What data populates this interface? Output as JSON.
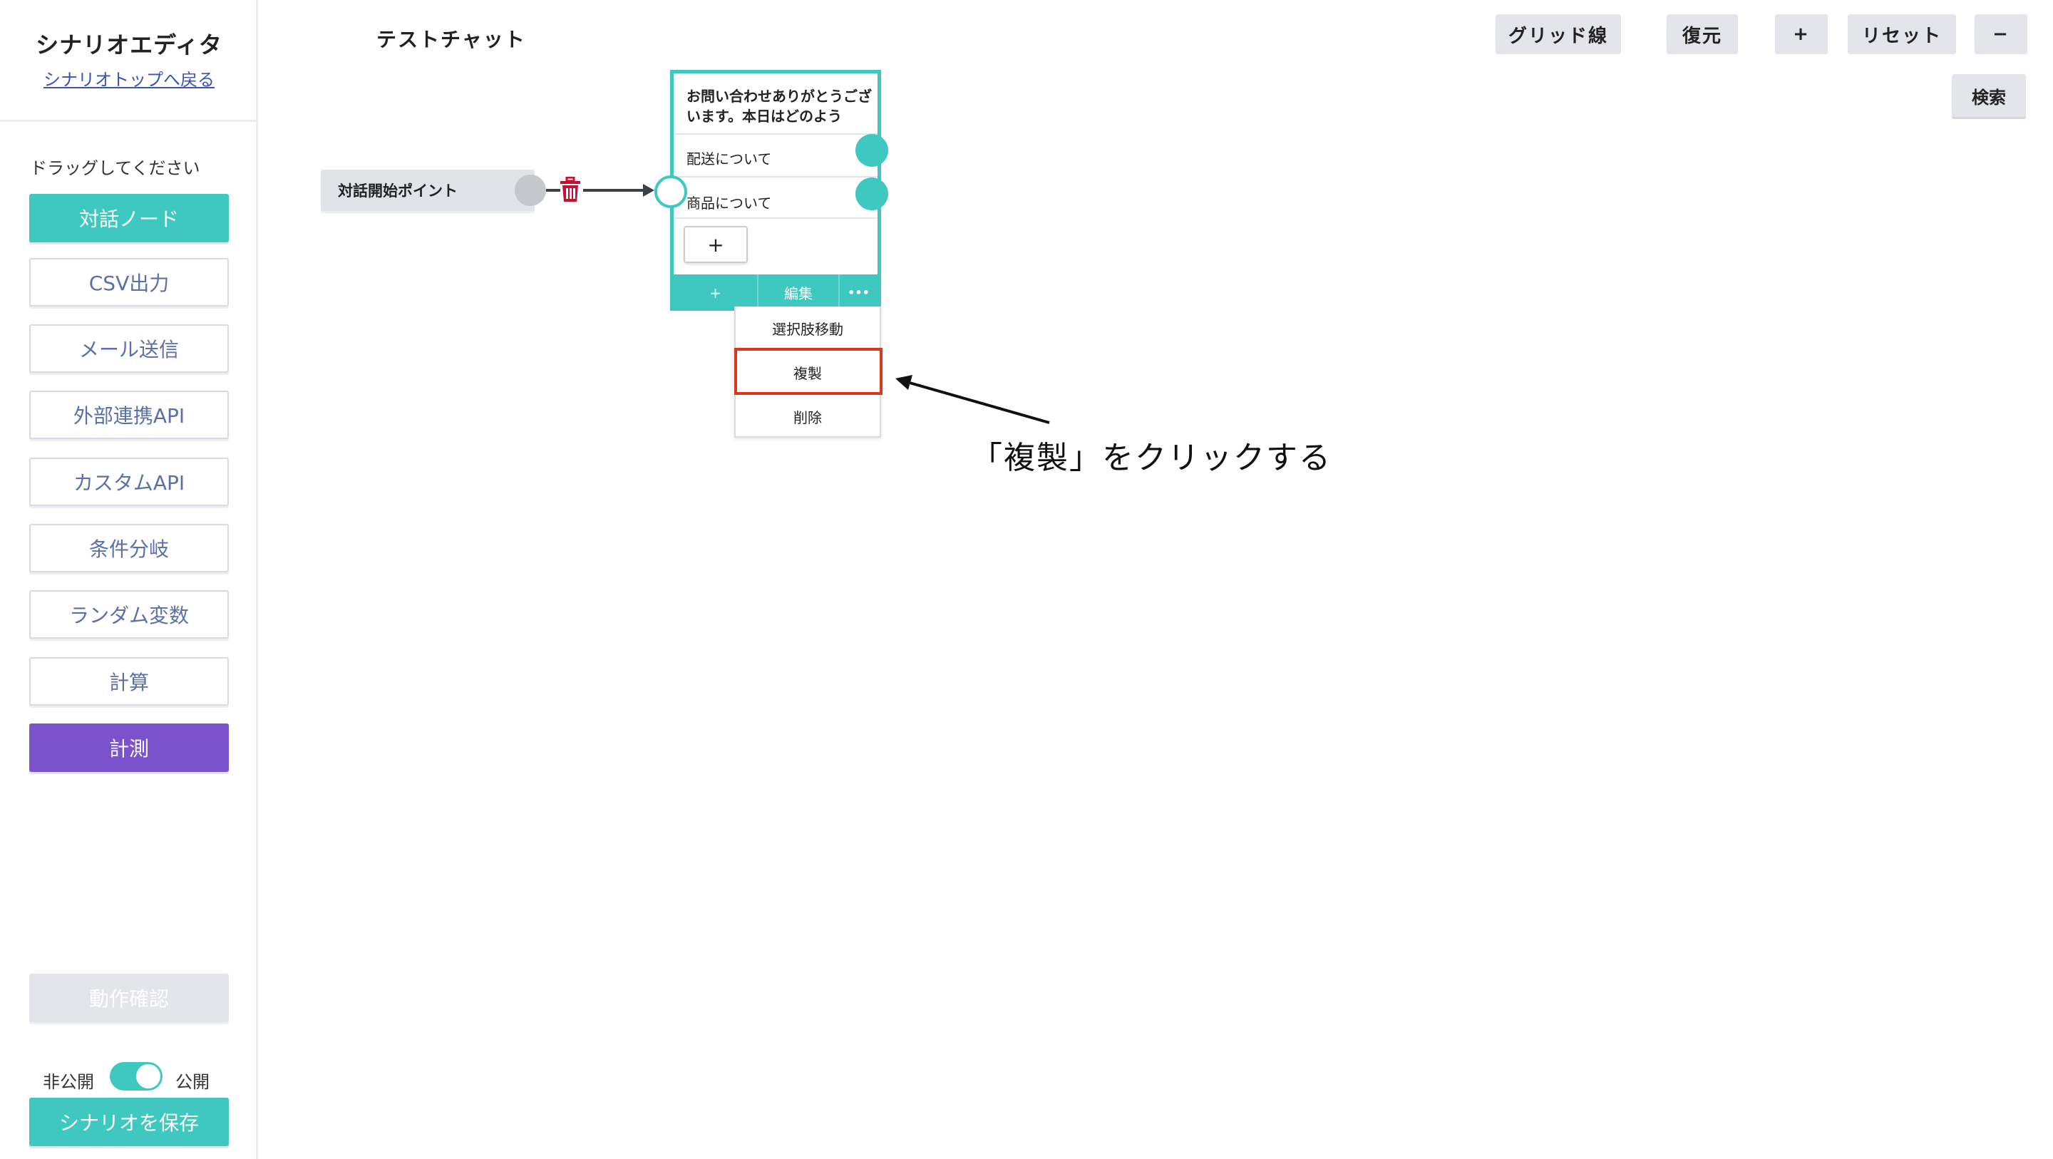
{
  "sidebar": {
    "title": "シナリオエディタ",
    "back_link": "シナリオトップへ戻る",
    "drag_hint": "ドラッグしてください",
    "buttons": [
      "対話ノード",
      "CSV出力",
      "メール送信",
      "外部連携API",
      "カスタムAPI",
      "条件分岐",
      "ランダム変数",
      "計算",
      "計測"
    ],
    "preview_button": "動作確認",
    "toggle": {
      "off_label": "非公開",
      "on_label": "公開",
      "state": "on"
    },
    "save_button": "シナリオを保存"
  },
  "header": {
    "chat_title": "テストチャット",
    "buttons": [
      "グリッド線",
      "復元",
      "+",
      "リセット",
      "−"
    ],
    "search_button": "検索"
  },
  "canvas": {
    "start_node": "対話開始ポイント",
    "dialog_node": {
      "message": "お問い合わせありがとうございます。本日はどのよう",
      "choices": [
        "配送について",
        "商品について"
      ],
      "add_choice": "+",
      "footer": [
        "+",
        "編集",
        "•••"
      ]
    },
    "menu": {
      "items": [
        "選択肢移動",
        "複製",
        "削除"
      ],
      "highlighted": "複製"
    },
    "annotation": "「複製」をクリックする"
  },
  "colors": {
    "accent": "#3fc8bf",
    "purple": "#7a52cc",
    "highlight": "#d9381e",
    "trash": "#c8102e",
    "link": "#3d52b8"
  }
}
